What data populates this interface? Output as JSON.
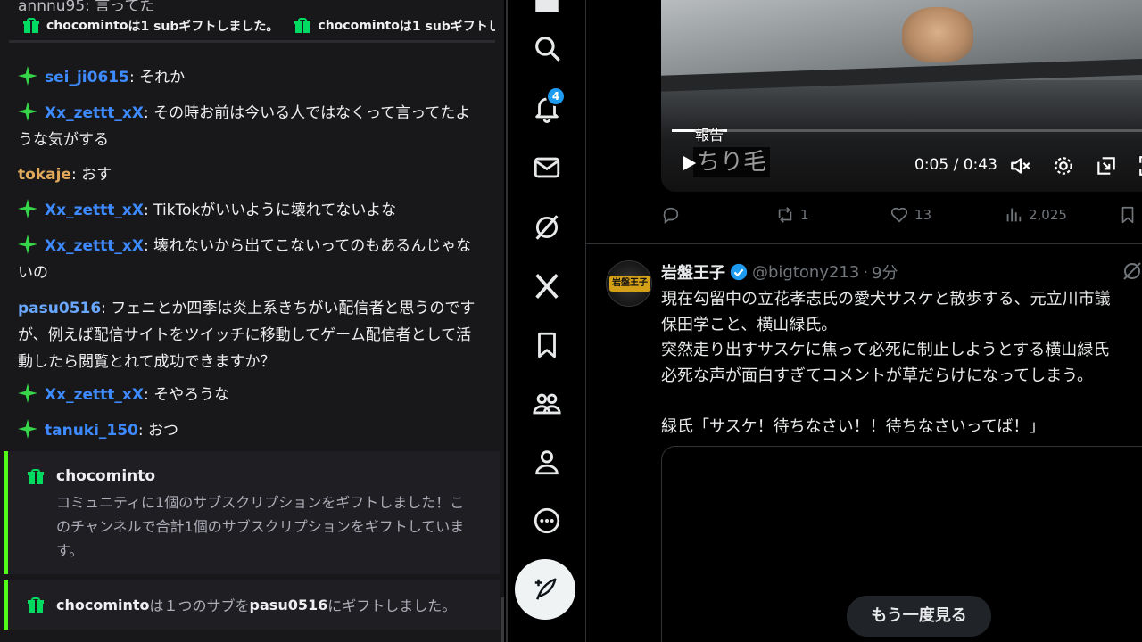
{
  "chat": {
    "ticker": [
      {
        "user": "chocominto",
        "text": "は1 subギフトしました。"
      },
      {
        "user": "chocominto",
        "text": "は1 subギフトしま"
      }
    ],
    "partial_top_line": "annnu95: 言ってた",
    "messages": [
      {
        "badge": "star-badge",
        "user": "sei_ji0615",
        "text": ": それか"
      },
      {
        "badge": "star-badge",
        "user": "Xx_zettt_xX",
        "text": ": その時お前は今いる人ではなくって言ってたような気がする"
      },
      {
        "badge": null,
        "user": "tokaje",
        "text": ": おす"
      },
      {
        "badge": "star-badge",
        "user": "Xx_zettt_xX",
        "text": ": TikTokがいいように壊れてないよな"
      },
      {
        "badge": "star-badge",
        "user": "Xx_zettt_xX",
        "text": ": 壊れないから出てこないってのもあるんじゃないの"
      },
      {
        "badge": null,
        "user": "pasu0516",
        "text": ": フェニとか四季は炎上系きちがい配信者と思うのですが、例えば配信サイトをツイッチに移動してゲーム配信者として活動したら閲覧とれて成功できますか？"
      },
      {
        "badge": "star-badge",
        "user": "Xx_zettt_xX",
        "text": ": そやろうな"
      },
      {
        "badge": "star-badge",
        "user": "tanuki_150",
        "text": ": おつ"
      }
    ],
    "notice1": {
      "user": "chocominto",
      "body": "コミュニティに1個のサブスクリプションをギフトしました！このチャンネルで合計1個のサブスクリプションをギフトしています。"
    },
    "notice2": {
      "gifter": "chocominto",
      "middle": "は１つのサブを",
      "recipient": "pasu0516",
      "end": "にギフトしました。"
    }
  },
  "nav": {
    "items": [
      "home-icon",
      "search-icon",
      "notifications-icon",
      "messages-icon",
      "grok-icon",
      "x-premium-icon",
      "bookmarks-icon",
      "communities-icon",
      "profile-icon",
      "more-icon"
    ],
    "notification_count": "4",
    "post_icon": "compose-icon"
  },
  "tweet1": {
    "video": {
      "caption_small": "報告",
      "caption_big": "ちり毛",
      "time": "0:05 / 0:43",
      "progress": 0.116
    },
    "actions": {
      "replies": "",
      "reposts": "1",
      "likes": "13",
      "views": "2,025"
    }
  },
  "tweet2": {
    "avatar_text": "岩盤王子",
    "name": "岩盤王子",
    "handle": "@bigtony213",
    "time": "9分",
    "text": "現在勾留中の立花孝志氏の愛犬サスケと散歩する、元立川市議\n保田学こと、横山緑氏。\n突然走り出すサスケに焦って必死に制止しようとする横山緑氏\n必死な声が面白すぎてコメントが草だらけになってしまう。\n\n緑氏「サスケ！待ちなさい！！待ちなさいってば！」",
    "replay_label": "もう一度見る"
  },
  "colors": {
    "twitch_green": "#53fc18",
    "gift_green": "#00db62",
    "x_blue": "#1d9bf0",
    "user_blue": "#3d8bff",
    "user_orange": "#e0a85a"
  }
}
